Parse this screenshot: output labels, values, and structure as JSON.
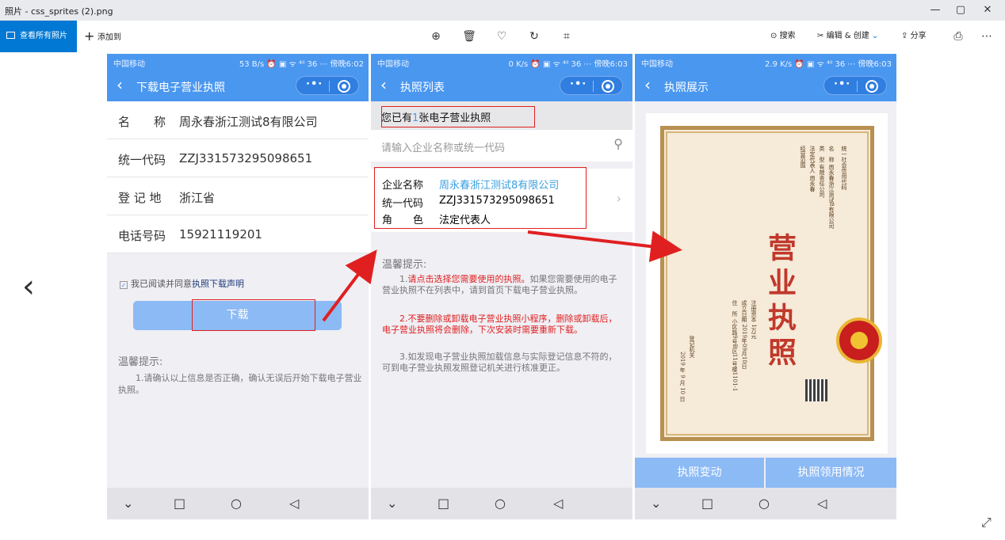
{
  "window": {
    "title": "照片 - css_sprites (2).png",
    "controls": [
      "—",
      "▢",
      "✕"
    ]
  },
  "toolbar": {
    "view_all": "查看所有照片",
    "add_to": "添加到",
    "search": "搜索",
    "edit_create": "编辑 & 创建",
    "share": "分享"
  },
  "phone1": {
    "status_left": "中国移动",
    "status_right": "53 B/s ⏰ ▣ ᯤ ⁴ˡˡ 36 ⋯ 傍晚6:02",
    "title": "下载电子营业执照",
    "rows": [
      {
        "label": "名　　称",
        "value": "周永春浙江测试8有限公司"
      },
      {
        "label": "统一代码",
        "value": "ZZJ331573295098651"
      },
      {
        "label": "登 记 地",
        "value": "浙江省"
      },
      {
        "label": "电话号码",
        "value": "15921119201"
      }
    ],
    "agree_text": "我已阅读并同意",
    "agree_link": "执照下载声明",
    "download": "下载",
    "tip_title": "温馨提示:",
    "tip_body": "1.请确认以上信息是否正确，确认无误后开始下载电子营业执照。"
  },
  "phone2": {
    "status_left": "中国移动",
    "status_right": "0 K/s ⏰ ▣ ᯤ ⁴ˡˡ 36 ⋯ 傍晚6:03",
    "title": "执照列表",
    "count_pre": "您已有",
    "count_num": "1",
    "count_post": "张电子营业执照",
    "search_placeholder": "请输入企业名称或统一代码",
    "card": {
      "name_label": "企业名称",
      "name_value": "周永春浙江测试8有限公司",
      "code_label": "统一代码",
      "code_value": "ZZJ331573295098651",
      "role_label": "角　　色",
      "role_value": "法定代表人"
    },
    "tip_title": "温馨提示:",
    "tip1_pre": "1.",
    "tip1_red": "请点击选择您需要使用的执照。",
    "tip1_rest": "如果您需要使用的电子营业执照不在列表中，请到首页下载电子营业执照。",
    "tip2": "2.不要删除或卸载电子营业执照小程序，删除或卸载后，电子营业执照将会删除，下次安装时需要重新下载。",
    "tip3": "3.如发现电子营业执照加载信息与实际登记信息不符的，可到电子营业执照发照登记机关进行核准更正。"
  },
  "phone3": {
    "status_left": "中国移动",
    "status_right": "2.9 K/s ⏰ ▣ ᯤ ⁴ˡˡ 36 ⋯ 傍晚6:03",
    "title": "执照展示",
    "cert_title": "营业执照",
    "cert_col1": "统一社会信用代码",
    "cert_col2": "名　称 周永春浙江测试8有限公司",
    "cert_col3": "类　型 有限责任公司",
    "cert_col4": "法定代表人 周永春",
    "cert_col5": "经营范围",
    "cert_col6": "注册资本 1万元",
    "cert_col7": "成立日期 2019年09月10日",
    "cert_col8": "住　所 小区路9号B区11号楼1101-1",
    "cert_col9": "登记机关",
    "cert_date": "2019 年 9 月 10 日",
    "btn_change": "执照变动",
    "btn_usage": "执照领用情况"
  },
  "nav": {
    "back": "◁",
    "home": "○",
    "recent": "□",
    "down": "⌄"
  }
}
